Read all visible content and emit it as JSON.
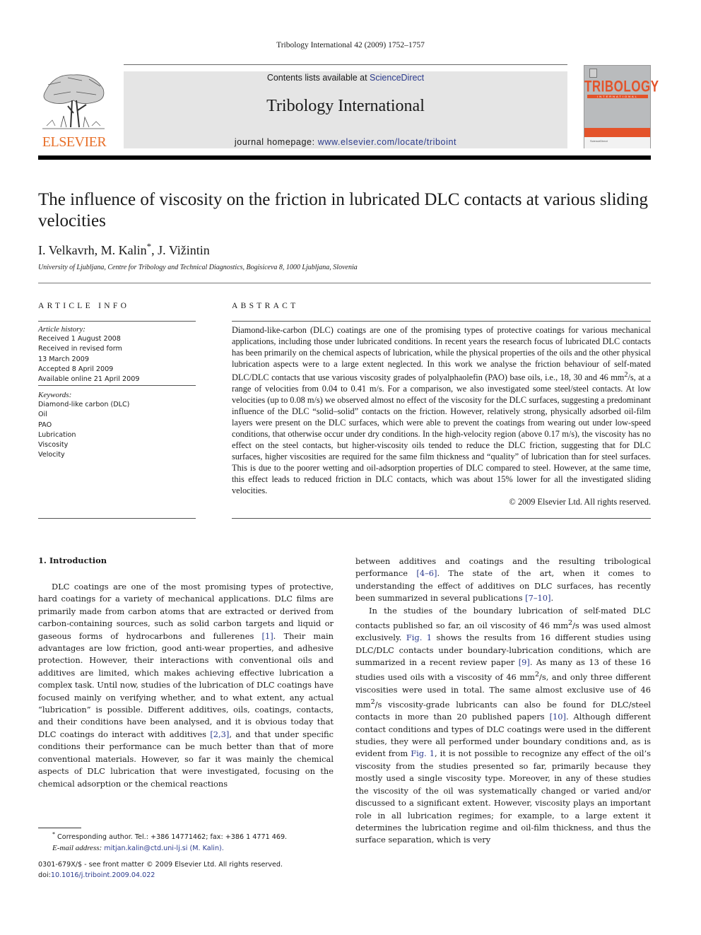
{
  "running_head": "Tribology International 42 (2009) 1752–1757",
  "header": {
    "publisher_logo_text": "ELSEVIER",
    "contents_prefix": "Contents lists available at ",
    "contents_link": "ScienceDirect",
    "journal_title": "Tribology International",
    "homepage_prefix": "journal homepage: ",
    "homepage_link": "www.elsevier.com/locate/triboint",
    "cover": {
      "title": "TRIBOLOGY",
      "subtitle": "INTERNATIONAL",
      "footer_brand": "ScienceDirect"
    },
    "colors": {
      "elsevier_orange": "#e8702a",
      "cover_orange": "#e4532a",
      "link_blue": "#2b3a8c",
      "banner_gray": "#e5e5e5"
    }
  },
  "article": {
    "title": "The influence of viscosity on the friction in lubricated DLC contacts at various sliding velocities",
    "authors": [
      {
        "name": "I. Velkavrh",
        "mark": ""
      },
      {
        "name": "M. Kalin",
        "mark": "*"
      },
      {
        "name": "J. Vižintin",
        "mark": ""
      }
    ],
    "affiliation": "University of Ljubljana, Centre for Tribology and Technical Diagnostics, Bogisiceva 8, 1000 Ljubljana, Slovenia"
  },
  "article_info": {
    "heading": "ARTICLE INFO",
    "history_label": "Article history:",
    "history": [
      "Received 1 August 2008",
      "Received in revised form",
      "13 March 2009",
      "Accepted 8 April 2009",
      "Available online 21 April 2009"
    ],
    "keywords_label": "Keywords:",
    "keywords": [
      "Diamond-like carbon (DLC)",
      "Oil",
      "PAO",
      "Lubrication",
      "Viscosity",
      "Velocity"
    ]
  },
  "abstract": {
    "heading": "ABSTRACT",
    "text_part1": "Diamond-like-carbon (DLC) coatings are one of the promising types of protective coatings for various mechanical applications, including those under lubricated conditions. In recent years the research focus of lubricated DLC contacts has been primarily on the chemical aspects of lubrication, while the physical properties of the oils and the other physical lubrication aspects were to a large extent neglected. In this work we analyse the friction behaviour of self-mated DLC/DLC contacts that use various viscosity grades of polyalphaolefin (PAO) base oils, i.e., 18, 30 and 46 mm",
    "sup": "2",
    "text_part2": "/s, at a range of velocities from 0.04 to 0.41 m/s. For a comparison, we also investigated some steel/steel contacts. At low velocities (up to 0.08 m/s) we observed almost no effect of the viscosity for the DLC surfaces, suggesting a predominant influence of the DLC “solid–solid” contacts on the friction. However, relatively strong, physically adsorbed oil-film layers were present on the DLC surfaces, which were able to prevent the coatings from wearing out under low-speed conditions, that otherwise occur under dry conditions. In the high-velocity region (above 0.17 m/s), the viscosity has no effect on the steel contacts, but higher-viscosity oils tended to reduce the DLC friction, suggesting that for DLC surfaces, higher viscosities are required for the same film thickness and “quality” of lubrication than for steel surfaces. This is due to the poorer wetting and oil-adsorption properties of DLC compared to steel. However, at the same time, this effect leads to reduced friction in DLC contacts, which was about 15% lower for all the investigated sliding velocities.",
    "copyright": "© 2009 Elsevier Ltd. All rights reserved."
  },
  "body": {
    "section1_title": "1.  Introduction",
    "left": {
      "p1_a": "DLC coatings are one of the most promising types of protective, hard coatings for a variety of mechanical applications. DLC films are primarily made from carbon atoms that are extracted or derived from carbon-containing sources, such as solid carbon targets and liquid or gaseous forms of hydrocarbons and fullerenes ",
      "ref1": "[1]",
      "p1_b": ". Their main advantages are low friction, good anti-wear properties, and adhesive protection. However, their interactions with conventional oils and additives are limited, which makes achieving effective lubrication a complex task. Until now, studies of the lubrication of DLC coatings have focused mainly on verifying whether, and to what extent, any actual “lubrication” is possible. Different additives, oils, coatings, contacts, and their conditions have been analysed, and it is obvious today that DLC coatings do interact with additives ",
      "ref2": "[2,3]",
      "p1_c": ", and that under specific conditions their performance can be much better than that of more conventional materials. However, so far it was mainly the chemical aspects of DLC lubrication that were investigated, focusing on the chemical adsorption or the chemical reactions"
    },
    "right": {
      "p1_a": "between additives and coatings and the resulting tribological performance ",
      "ref4": "[4–6]",
      "p1_b": ". The state of the art, when it comes to understanding the effect of additives on DLC surfaces, has recently been summarized in several publications ",
      "ref7": "[7–10]",
      "p1_c": ".",
      "p2_a": "In the studies of the boundary lubrication of self-mated DLC contacts published so far, an oil viscosity of 46 mm",
      "p2_sup1": "2",
      "p2_b": "/s was used almost exclusively. ",
      "fig1a": "Fig. 1",
      "p2_c": " shows the results from 16 different studies using DLC/DLC contacts under boundary-lubrication conditions, which are summarized in a recent review paper ",
      "ref9": "[9]",
      "p2_d": ". As many as 13 of these 16 studies used oils with a viscosity of 46 mm",
      "p2_sup2": "2",
      "p2_e": "/s, and only three different viscosities were used in total. The same almost exclusive use of 46 mm",
      "p2_sup3": "2",
      "p2_f": "/s viscosity-grade lubricants can also be found for DLC/steel contacts in more than 20 published papers ",
      "ref10": "[10]",
      "p2_g": ". Although different contact conditions and types of DLC coatings were used in the different studies, they were all performed under boundary conditions and, as is evident from ",
      "fig1b": "Fig. 1",
      "p2_h": ", it is not possible to recognize any effect of the oil’s viscosity from the studies presented so far, primarily because they mostly used a single viscosity type. Moreover, in any of these studies the viscosity of the oil was systematically changed or varied and/or discussed to a significant extent. However, viscosity plays an important role in all lubrication regimes; for example, to a large extent it determines the lubrication regime and oil-film thickness, and thus the surface separation, which is very"
    }
  },
  "footnotes": {
    "mark": "*",
    "corresponding": " Corresponding author. Tel.: +386 14771462; fax: +386 1 4771 469.",
    "email_label": "E-mail address:",
    "email": "mitjan.kalin@ctd.uni-lj.si (M. Kalin).",
    "front_matter": "0301-679X/$ - see front matter © 2009 Elsevier Ltd. All rights reserved.",
    "doi_prefix": "doi:",
    "doi": "10.1016/j.triboint.2009.04.022"
  }
}
